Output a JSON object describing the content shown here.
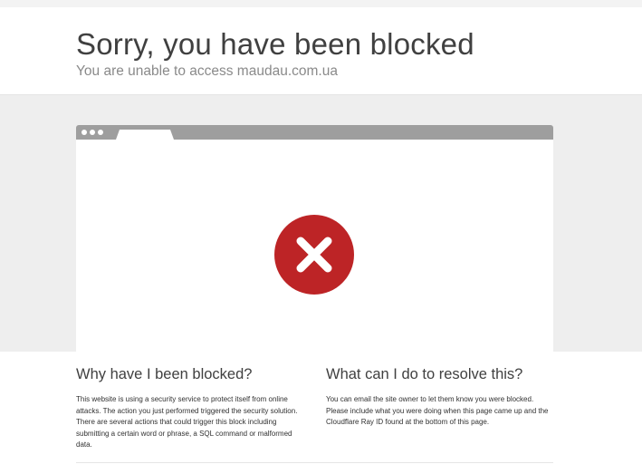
{
  "header": {
    "title": "Sorry, you have been blocked",
    "subtitle": "You are unable to access maudau.com.ua"
  },
  "browser_illustration": {
    "icon": "error-x-circle-icon",
    "colors": {
      "error": "#bd2426",
      "bar": "#9e9e9e"
    }
  },
  "why": {
    "heading": "Why have I been blocked?",
    "body": "This website is using a security service to protect itself from online attacks. The action you just performed triggered the security solution. There are several actions that could trigger this block including submitting a certain word or phrase, a SQL command or malformed data."
  },
  "resolve": {
    "heading": "What can I do to resolve this?",
    "body": "You can email the site owner to let them know you were blocked. Please include what you were doing when this page came up and the Cloudflare Ray ID found at the bottom of this page."
  }
}
